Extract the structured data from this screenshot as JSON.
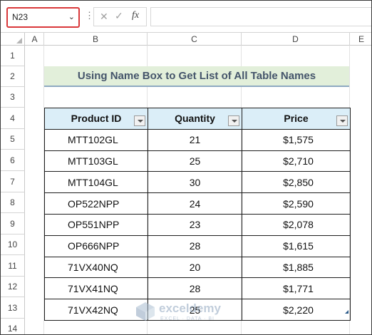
{
  "formula_bar": {
    "name_box_value": "N23",
    "name_box_dropdown_glyph": "⌄",
    "more_glyph": "⋮",
    "cancel_glyph": "✕",
    "enter_glyph": "✓",
    "fx_label": "fx",
    "formula_value": ""
  },
  "columns": [
    "A",
    "B",
    "C",
    "D",
    "E"
  ],
  "rows": [
    "1",
    "2",
    "3",
    "4",
    "5",
    "6",
    "7",
    "8",
    "9",
    "10",
    "11",
    "12",
    "13",
    "14"
  ],
  "sheet": {
    "title": "Using Name Box to Get List of All Table Names"
  },
  "table": {
    "headers": [
      "Product ID",
      "Quantity",
      "Price"
    ],
    "rows": [
      {
        "product_id": "MTT102GL",
        "quantity": "21",
        "price": "$1,575"
      },
      {
        "product_id": "MTT103GL",
        "quantity": "25",
        "price": "$2,710"
      },
      {
        "product_id": "MTT104GL",
        "quantity": "30",
        "price": "$2,850"
      },
      {
        "product_id": "OP522NPP",
        "quantity": "24",
        "price": "$2,590"
      },
      {
        "product_id": "OP551NPP",
        "quantity": "23",
        "price": "$2,078"
      },
      {
        "product_id": "OP666NPP",
        "quantity": "28",
        "price": "$1,615"
      },
      {
        "product_id": "71VX40NQ",
        "quantity": "20",
        "price": "$1,885"
      },
      {
        "product_id": "71VX41NQ",
        "quantity": "28",
        "price": "$1,771"
      },
      {
        "product_id": "71VX42NQ",
        "quantity": "25",
        "price": "$2,220"
      }
    ]
  },
  "watermark": {
    "brand": "exceldemy",
    "tagline": "EXCEL · DATA · BI"
  },
  "colors": {
    "name_box_highlight": "#d9383a",
    "title_fill": "#e2efda",
    "title_text": "#44546a",
    "header_fill": "#dbeef8"
  }
}
